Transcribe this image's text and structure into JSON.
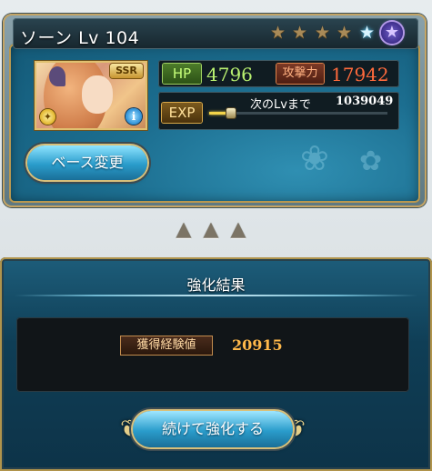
{
  "character": {
    "name_level": "ソーン Lv 104",
    "rarity_badge": "SSR",
    "stars": {
      "filled": 4,
      "blue": 1,
      "special": 1
    }
  },
  "stats": {
    "hp_label": "HP",
    "hp_value": "4796",
    "atk_label": "攻撃力",
    "atk_value": "17942",
    "exp_label": "EXP",
    "exp_next_label": "次のLvまで",
    "exp_next_value": "1039049",
    "exp_progress": 0.1
  },
  "buttons": {
    "base_change": "ベース変更",
    "continue_upgrade": "続けて強化する"
  },
  "result": {
    "title": "強化結果",
    "exp_gained_label": "獲得経験値",
    "exp_gained_value": "20915"
  },
  "colors": {
    "panel_blue": "#1c6e90",
    "gold_trim": "#b99850",
    "hp_green": "#b8f070",
    "atk_orange": "#ff6a3c",
    "exp_gain_orange": "#ffb84a"
  },
  "icons": [
    "star-icon",
    "star-blue-icon",
    "special-star-icon",
    "element-light-icon",
    "info-icon",
    "upgrade-arrow-icon"
  ]
}
